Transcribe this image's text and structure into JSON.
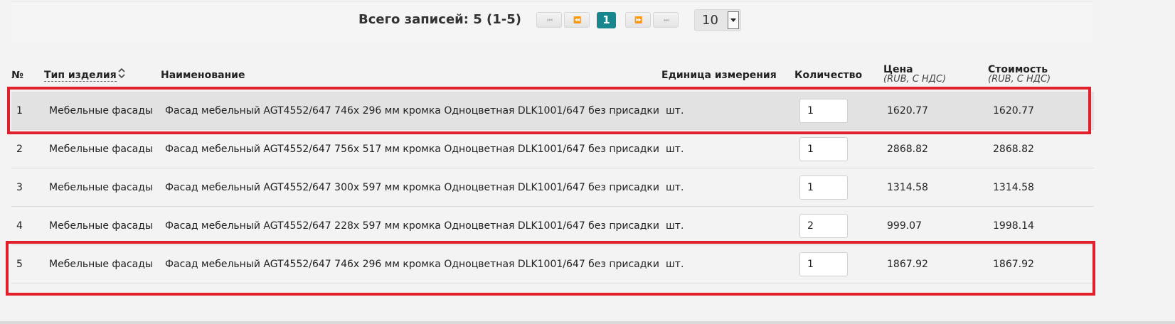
{
  "pager": {
    "total_text": "Всего записей: 5 (1-5)",
    "first_icon": "⏮",
    "prev_icon": "⏪",
    "current_page": "1",
    "next_icon": "⏩",
    "last_icon": "⏭",
    "page_size": "10"
  },
  "table": {
    "headers": {
      "num": "№",
      "type": "Тип изделия",
      "name": "Наименование",
      "unit": "Единица измерения",
      "qty": "Количество",
      "price": "Цена",
      "price_sub": "(RUB, С НДС)",
      "cost": "Стоимость",
      "cost_sub": "(RUB, С НДС)"
    },
    "rows": [
      {
        "num": "1",
        "type": "Мебельные фасады",
        "name": "Фасад мебельный AGT4552/647 746x 296 мм кромка Одноцветная DLK1001/647 без присадки",
        "unit": "шт.",
        "qty": "1",
        "price": "1620.77",
        "cost": "1620.77"
      },
      {
        "num": "2",
        "type": "Мебельные фасады",
        "name": "Фасад мебельный AGT4552/647 756x 517 мм кромка Одноцветная DLK1001/647 без присадки",
        "unit": "шт.",
        "qty": "1",
        "price": "2868.82",
        "cost": "2868.82"
      },
      {
        "num": "3",
        "type": "Мебельные фасады",
        "name": "Фасад мебельный AGT4552/647 300x 597 мм кромка Одноцветная DLK1001/647 без присадки",
        "unit": "шт.",
        "qty": "1",
        "price": "1314.58",
        "cost": "1314.58"
      },
      {
        "num": "4",
        "type": "Мебельные фасады",
        "name": "Фасад мебельный AGT4552/647 228x 597 мм кромка Одноцветная DLK1001/647 без присадки",
        "unit": "шт.",
        "qty": "2",
        "price": "999.07",
        "cost": "1998.14"
      },
      {
        "num": "5",
        "type": "Мебельные фасады",
        "name": "Фасад мебельный AGT4552/647 746x 296 мм кромка Одноцветная DLK1001/647 без присадки",
        "unit": "шт.",
        "qty": "1",
        "price": "1867.92",
        "cost": "1867.92"
      }
    ]
  },
  "colors": {
    "accent": "#17868f",
    "highlight": "#e2202b",
    "selected_row": "#e2e2e2"
  }
}
